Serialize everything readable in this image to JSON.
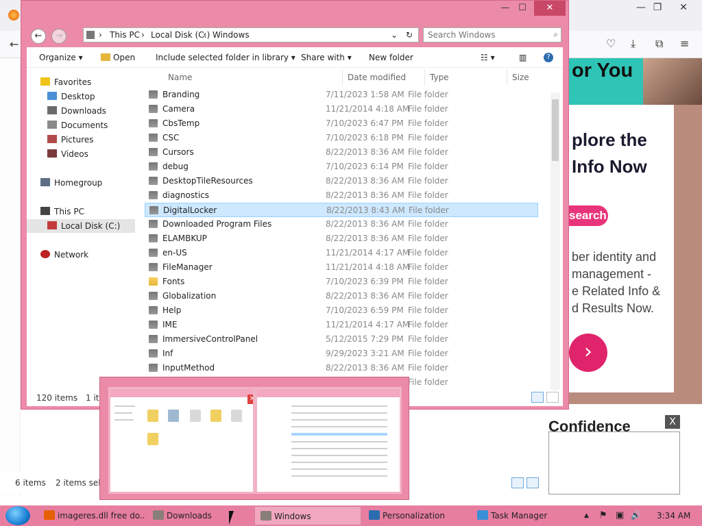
{
  "browser": {
    "controls": {
      "minimize": "—",
      "restore": "❐",
      "close": "✕"
    },
    "toolbar_icons": [
      "pocket-icon",
      "download-icon",
      "extensions-icon",
      "menu-icon"
    ],
    "ad": {
      "headline": "or You",
      "big_line1": "plore the",
      "big_line2": "Info Now",
      "search_badge": "search",
      "lines": [
        "ber identity and",
        "management -",
        "e Related Info &",
        "d Results Now."
      ],
      "go": "›",
      "accent": "#e0246c"
    },
    "ad2": {
      "text": "Confidence",
      "close": "X"
    }
  },
  "downloads_behind": {
    "items_count": "6 items",
    "selected_count": "2 items selec"
  },
  "explorer": {
    "controls": {
      "minimize": "—",
      "maximize": "☐",
      "close": "✕"
    },
    "address": {
      "crumb1": "This PC",
      "crumb2": "Local Disk (C:)",
      "crumb3": "Windows"
    },
    "search": {
      "placeholder": "Search Windows"
    },
    "toolbar": {
      "organize": "Organize",
      "open": "Open",
      "include": "Include selected folder in library",
      "share": "Share with",
      "new_folder": "New folder"
    },
    "nav": {
      "favorites": "Favorites",
      "desktop": "Desktop",
      "downloads": "Downloads",
      "documents": "Documents",
      "pictures": "Pictures",
      "videos": "Videos",
      "homegroup": "Homegroup",
      "this_pc": "This PC",
      "local_disk": "Local Disk (C:)",
      "network": "Network"
    },
    "columns": {
      "name": "Name",
      "date": "Date modified",
      "type": "Type",
      "size": "Size"
    },
    "rows": [
      {
        "name": "Branding",
        "date": "7/11/2023 1:58 AM",
        "type": "File folder"
      },
      {
        "name": "Camera",
        "date": "11/21/2014 4:18 AM",
        "type": "File folder"
      },
      {
        "name": "CbsTemp",
        "date": "7/10/2023 6:47 PM",
        "type": "File folder"
      },
      {
        "name": "CSC",
        "date": "7/10/2023 6:18 PM",
        "type": "File folder"
      },
      {
        "name": "Cursors",
        "date": "8/22/2013 8:36 AM",
        "type": "File folder"
      },
      {
        "name": "debug",
        "date": "7/10/2023 6:14 PM",
        "type": "File folder"
      },
      {
        "name": "DesktopTileResources",
        "date": "8/22/2013 8:36 AM",
        "type": "File folder"
      },
      {
        "name": "diagnostics",
        "date": "8/22/2013 8:36 AM",
        "type": "File folder"
      },
      {
        "name": "DigitalLocker",
        "date": "8/22/2013 8:43 AM",
        "type": "File folder"
      },
      {
        "name": "Downloaded Program Files",
        "date": "8/22/2013 8:36 AM",
        "type": "File folder"
      },
      {
        "name": "ELAMBKUP",
        "date": "8/22/2013 8:36 AM",
        "type": "File folder"
      },
      {
        "name": "en-US",
        "date": "11/21/2014 4:17 AM",
        "type": "File folder"
      },
      {
        "name": "FileManager",
        "date": "11/21/2014 4:18 AM",
        "type": "File folder"
      },
      {
        "name": "Fonts",
        "date": "7/10/2023 6:39 PM",
        "type": "File folder"
      },
      {
        "name": "Globalization",
        "date": "8/22/2013 8:36 AM",
        "type": "File folder"
      },
      {
        "name": "Help",
        "date": "7/10/2023 6:59 PM",
        "type": "File folder"
      },
      {
        "name": "IME",
        "date": "11/21/2014 4:17 AM",
        "type": "File folder"
      },
      {
        "name": "ImmersiveControlPanel",
        "date": "5/12/2015 7:29 PM",
        "type": "File folder"
      },
      {
        "name": "Inf",
        "date": "9/29/2023 3:21 AM",
        "type": "File folder"
      },
      {
        "name": "InputMethod",
        "date": "8/22/2013 8:36 AM",
        "type": "File folder"
      },
      {
        "name": "",
        "date": "",
        "type": "File folder"
      }
    ],
    "status": {
      "items": "120 items",
      "selected": "1 ite"
    }
  },
  "taskbar": {
    "tasks": [
      {
        "label": "imageres.dll free do...",
        "color": "#e66000"
      },
      {
        "label": "Downloads",
        "color": "#8a7f78"
      },
      {
        "label": "Windows",
        "color": "#8a7f78"
      },
      {
        "label": "Personalization",
        "color": "#2b6cb0"
      },
      {
        "label": "Task Manager",
        "color": "#3a8fd6"
      }
    ],
    "tray_icons": [
      "chevron-up-icon",
      "flag-icon",
      "network-icon",
      "volume-icon"
    ],
    "tray": {
      "chevron": "▲",
      "flag": "⚑",
      "network": "▣",
      "volume": "🔊"
    },
    "clock": "3:34 AM"
  }
}
